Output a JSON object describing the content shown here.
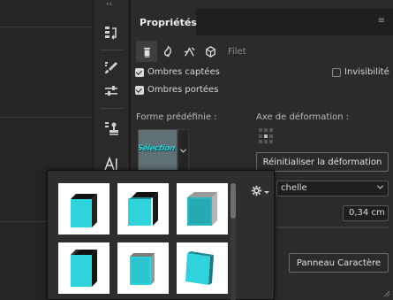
{
  "panel": {
    "tab_title": "Propriétés",
    "tabs_menu_glyph": "≡",
    "collapse_glyph": "‹‹",
    "icons": [
      "emboss-icon",
      "inflate-icon",
      "twist-icon",
      "bevel-icon"
    ],
    "filet_label": "Filet"
  },
  "options": {
    "shadows_cast": {
      "label": "Ombres captées",
      "checked": true
    },
    "shadows_received": {
      "label": "Ombres portées",
      "checked": true
    },
    "invisibility": {
      "label": "Invisibilité",
      "checked": false
    }
  },
  "deform": {
    "preset_label": "Forme prédéfinie :",
    "preset_preview_text": "Sélection",
    "axis_label": "Axe de déformation :",
    "reset_button": "Réinitialiser la déformation",
    "scale_select_value": "chelle",
    "depth_value": "0,34 cm",
    "panel_button": "Panneau Caractère"
  },
  "popup": {
    "thumbnails": [
      {
        "name": "cube-preset-1"
      },
      {
        "name": "cube-preset-2"
      },
      {
        "name": "cube-preset-3"
      },
      {
        "name": "cube-preset-4"
      },
      {
        "name": "cube-preset-5"
      },
      {
        "name": "cube-preset-6"
      }
    ]
  },
  "colors": {
    "cube_cyan": "#2ed3dc",
    "cube_dark": "#1a1a1a",
    "accent_text": "#d6d6d6"
  }
}
